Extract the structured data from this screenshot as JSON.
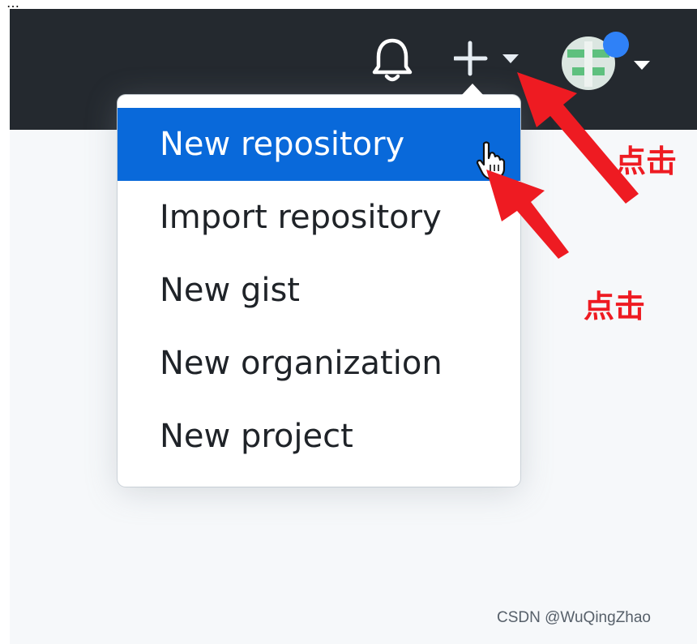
{
  "header": {
    "icons": {
      "notifications": "bell-icon",
      "create_new": "plus-icon",
      "dropdown": "caret-down-icon",
      "avatar": "avatar"
    }
  },
  "menu": {
    "items": [
      {
        "label": "New repository",
        "active": true
      },
      {
        "label": "Import repository",
        "active": false
      },
      {
        "label": "New gist",
        "active": false
      },
      {
        "label": "New organization",
        "active": false
      },
      {
        "label": "New project",
        "active": false
      }
    ]
  },
  "annotations": {
    "label_1": "点击",
    "label_2": "点击",
    "arrow_color": "#ee1b22"
  },
  "watermark": "CSDN @WuQingZhao",
  "colors": {
    "header_bg": "#24292f",
    "active_item_bg": "#0969da",
    "page_bg": "#f6f8fa"
  }
}
